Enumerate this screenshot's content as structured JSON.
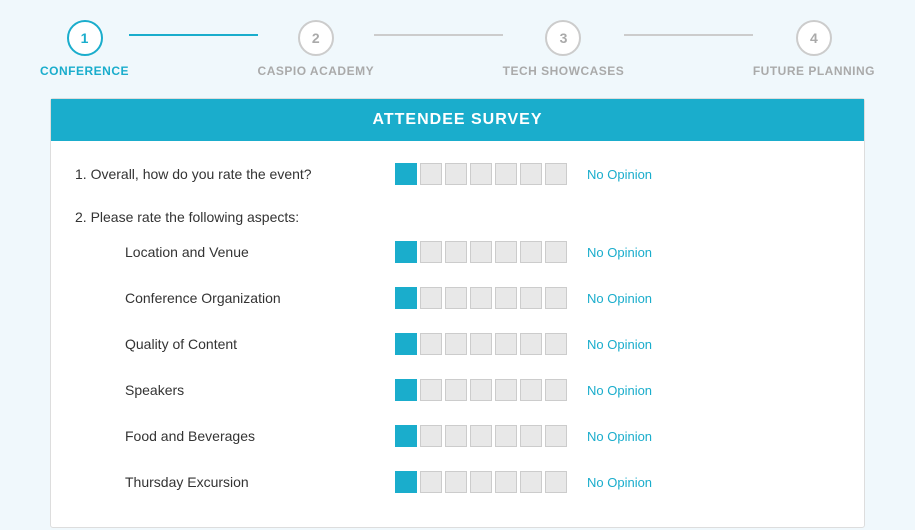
{
  "stepper": {
    "steps": [
      {
        "number": "1",
        "label": "CONFERENCE",
        "active": true
      },
      {
        "number": "2",
        "label": "CASPIO ACADEMY",
        "active": false
      },
      {
        "number": "3",
        "label": "TECH SHOWCASES",
        "active": false
      },
      {
        "number": "4",
        "label": "FUTURE PLANNING",
        "active": false
      }
    ],
    "lines": [
      {
        "active": true
      },
      {
        "active": false
      },
      {
        "active": false
      }
    ]
  },
  "survey": {
    "title": "ATTENDEE SURVEY",
    "questions": [
      {
        "id": "q1",
        "text": "1. Overall, how do you rate the event?",
        "indent": false,
        "boxes": 7,
        "selectedBox": 0,
        "showNoOpinion": true,
        "noOpinionLabel": "No Opinion"
      },
      {
        "id": "q2-header",
        "text": "2. Please rate the following aspects:",
        "indent": false,
        "isHeader": true
      },
      {
        "id": "q2-location",
        "text": "Location and Venue",
        "indent": true,
        "boxes": 7,
        "selectedBox": 0,
        "showNoOpinion": true,
        "noOpinionLabel": "No Opinion"
      },
      {
        "id": "q2-org",
        "text": "Conference Organization",
        "indent": true,
        "boxes": 7,
        "selectedBox": 0,
        "showNoOpinion": true,
        "noOpinionLabel": "No Opinion"
      },
      {
        "id": "q2-content",
        "text": "Quality of Content",
        "indent": true,
        "boxes": 7,
        "selectedBox": 0,
        "showNoOpinion": true,
        "noOpinionLabel": "No Opinion"
      },
      {
        "id": "q2-speakers",
        "text": "Speakers",
        "indent": true,
        "boxes": 7,
        "selectedBox": 0,
        "showNoOpinion": true,
        "noOpinionLabel": "No Opinion"
      },
      {
        "id": "q2-food",
        "text": "Food and Beverages",
        "indent": true,
        "boxes": 7,
        "selectedBox": 0,
        "showNoOpinion": true,
        "noOpinionLabel": "No Opinion"
      },
      {
        "id": "q2-excursion",
        "text": "Thursday Excursion",
        "indent": true,
        "boxes": 7,
        "selectedBox": 0,
        "showNoOpinion": true,
        "noOpinionLabel": "No Opinion"
      }
    ]
  },
  "colors": {
    "accent": "#1aadcc",
    "selected_box": "#1aadcc",
    "unselected_box": "#e8e8e8",
    "no_opinion": "#1aadcc"
  }
}
